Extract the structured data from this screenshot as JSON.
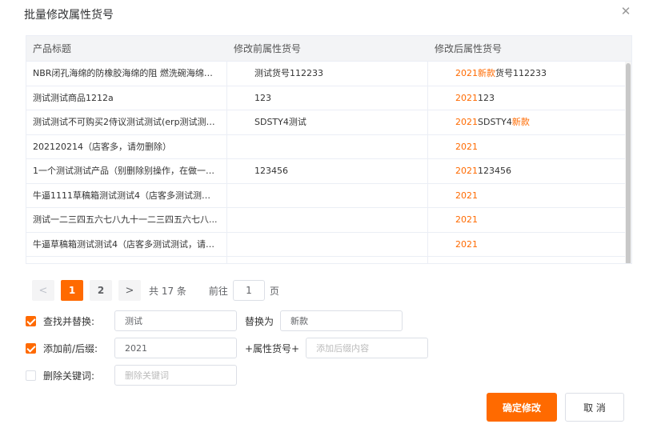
{
  "dialog": {
    "title": "批量修改属性货号",
    "close_glyph": "✕"
  },
  "table": {
    "headers": [
      "产品标题",
      "修改前属性货号",
      "修改后属性货号"
    ],
    "rows": [
      {
        "title": "NBR闭孔海绵的防橡胶海绵的阻 燃洗碗海绵雪...",
        "before": "测试货号112233",
        "after_prefix": "2021",
        "after_mid": "新款",
        "after_rest": "货号112233",
        "after_suffix": ""
      },
      {
        "title": "测试测试商品1212a",
        "before": "123",
        "after_prefix": "2021",
        "after_mid": "",
        "after_rest": "123",
        "after_suffix": ""
      },
      {
        "title": "测试测试不可购买2侍议测试测试(erp测试测试...",
        "before": "SDSTY4测试",
        "after_prefix": "2021",
        "after_mid": "",
        "after_rest": "SDSTY4",
        "after_suffix": "新款"
      },
      {
        "title": "202120214（店客多，请勿删除）",
        "before": "",
        "after_prefix": "2021",
        "after_mid": "",
        "after_rest": "",
        "after_suffix": ""
      },
      {
        "title": "1一个测试测试产品（别删除别操作，在做一件...",
        "before": "123456",
        "after_prefix": "2021",
        "after_mid": "",
        "after_rest": "123456",
        "after_suffix": ""
      },
      {
        "title": "牛逼1111草稿箱测试测试4（店客多测试测试，...",
        "before": "",
        "after_prefix": "2021",
        "after_mid": "",
        "after_rest": "",
        "after_suffix": ""
      },
      {
        "title": "测试一二三四五六七八九十一二三四五六七八...",
        "before": "",
        "after_prefix": "2021",
        "after_mid": "",
        "after_rest": "",
        "after_suffix": ""
      },
      {
        "title": "牛逼草稿箱测试测试4（店客多测试测试，请勿...",
        "before": "",
        "after_prefix": "2021",
        "after_mid": "",
        "after_rest": "",
        "after_suffix": ""
      },
      {
        "title": "",
        "before": "",
        "after_prefix": "",
        "after_mid": "",
        "after_rest": "",
        "after_suffix": ""
      }
    ]
  },
  "pagination": {
    "prev_glyph": "<",
    "next_glyph": ">",
    "pages": [
      "1",
      "2"
    ],
    "current": "1",
    "total_text": "共 17 条",
    "goto_label": "前往",
    "goto_value": "1",
    "page_label": "页"
  },
  "options": {
    "find_replace": {
      "label": "查找并替换:",
      "checked": true,
      "find_value": "测试",
      "replace_label": "替换为",
      "replace_value": "新款"
    },
    "add_affix": {
      "label": "添加前/后缀:",
      "checked": true,
      "prefix_value": "2021",
      "mid_label": "+属性货号+",
      "suffix_placeholder": "添加后缀内容"
    },
    "delete_keyword": {
      "label": "删除关键词:",
      "checked": false,
      "placeholder": "删除关键词"
    }
  },
  "buttons": {
    "confirm": "确定修改",
    "cancel": "取 消"
  },
  "colors": {
    "accent": "#ff6a00"
  }
}
